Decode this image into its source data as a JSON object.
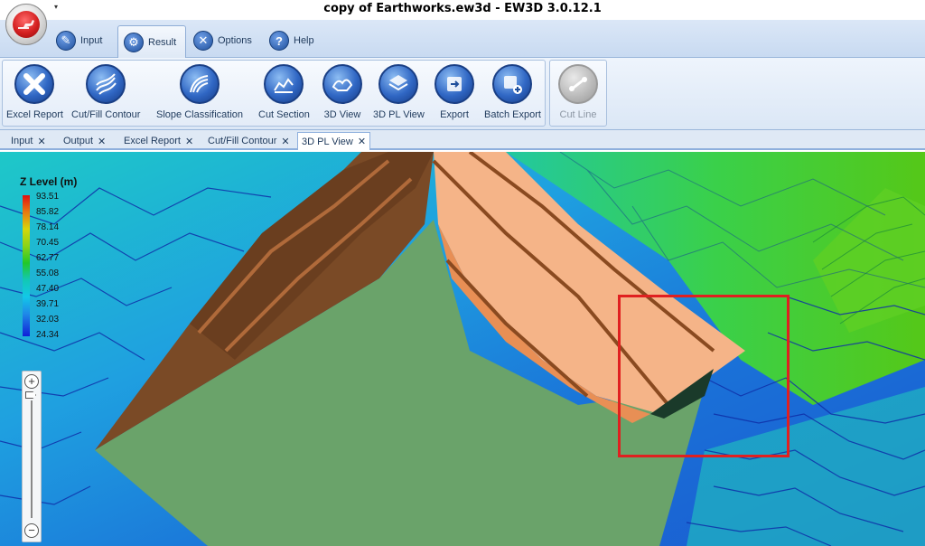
{
  "window": {
    "title": "copy of Earthworks.ew3d - EW3D 3.0.12.1"
  },
  "ribbon_tabs": [
    {
      "label": "Input",
      "icon": "input-icon"
    },
    {
      "label": "Result",
      "icon": "gear-icon",
      "active": true
    },
    {
      "label": "Options",
      "icon": "tools-icon"
    },
    {
      "label": "Help",
      "icon": "help-icon"
    }
  ],
  "ribbon_buttons": [
    {
      "label": "Excel Report",
      "icon": "excel-icon"
    },
    {
      "label": "Cut/Fill Contour",
      "icon": "contour-icon"
    },
    {
      "label": "Slope Classification",
      "icon": "slope-icon"
    },
    {
      "label": "Cut Section",
      "icon": "section-icon"
    },
    {
      "label": "3D View",
      "icon": "3d-view-icon"
    },
    {
      "label": "3D PL View",
      "icon": "3d-pl-view-icon"
    },
    {
      "label": "Export",
      "icon": "export-icon"
    },
    {
      "label": "Batch Export",
      "icon": "batch-export-icon"
    },
    {
      "label": "Cut Line",
      "icon": "cut-line-icon",
      "disabled": true
    }
  ],
  "doc_tabs": [
    {
      "label": "Input"
    },
    {
      "label": "Output"
    },
    {
      "label": "Excel Report"
    },
    {
      "label": "Cut/Fill Contour"
    },
    {
      "label": "3D PL View",
      "active": true
    }
  ],
  "legend": {
    "title": "Z Level (m)",
    "ticks": [
      "93.51",
      "85.82",
      "78.14",
      "70.45",
      "62.77",
      "55.08",
      "47.40",
      "39.71",
      "32.03",
      "24.34"
    ],
    "colors": {
      "high": "#e01010",
      "mid": "#22c828",
      "low": "#1020d8"
    }
  },
  "zoom": {
    "plus": "+",
    "minus": "−"
  },
  "colors": {
    "accent": "#3067c4",
    "highlight": "#e02020",
    "pad": "#6aa36a",
    "cut": "#f5b488",
    "fill": "#7a4a26"
  }
}
